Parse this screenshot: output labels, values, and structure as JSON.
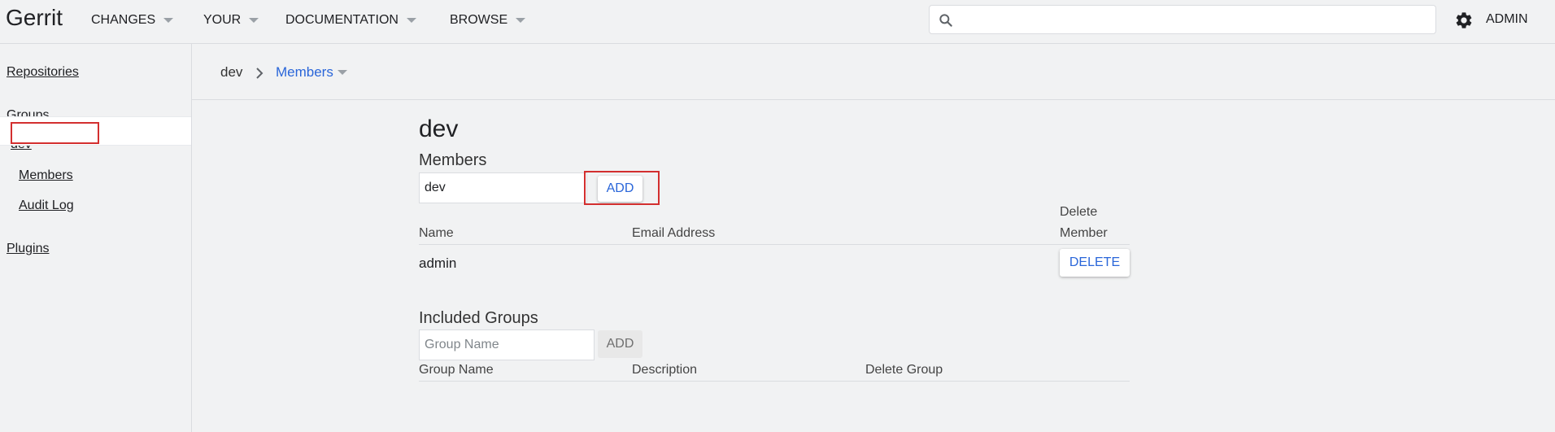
{
  "topbar": {
    "brand": "Gerrit",
    "menus": [
      {
        "label": "CHANGES"
      },
      {
        "label": "YOUR"
      },
      {
        "label": "DOCUMENTATION"
      },
      {
        "label": "BROWSE"
      }
    ],
    "search": {
      "value": "",
      "placeholder": ""
    },
    "account_label": "ADMIN"
  },
  "sidebar": {
    "repositories": "Repositories",
    "groups": "Groups",
    "group_name": "dev",
    "items": [
      {
        "label": "Members",
        "selected": true
      },
      {
        "label": "Audit Log",
        "selected": false
      }
    ],
    "plugins": "Plugins"
  },
  "breadcrumb": {
    "parent": "dev",
    "current": "Members"
  },
  "main": {
    "title": "dev",
    "members": {
      "title": "Members",
      "input_value": "dev",
      "add_label": "ADD",
      "columns": [
        "Name",
        "Email Address",
        "Delete",
        "Member"
      ],
      "rows": [
        {
          "name": "admin",
          "email": "",
          "delete_label": "DELETE"
        }
      ]
    },
    "included_groups": {
      "title": "Included Groups",
      "input_placeholder": "Group Name",
      "add_label": "ADD",
      "columns": [
        "Group Name",
        "Description",
        "Delete Group"
      ]
    }
  },
  "colors": {
    "accent": "#2a66d9",
    "highlight": "#d32f2f",
    "background": "#f1f2f3"
  }
}
